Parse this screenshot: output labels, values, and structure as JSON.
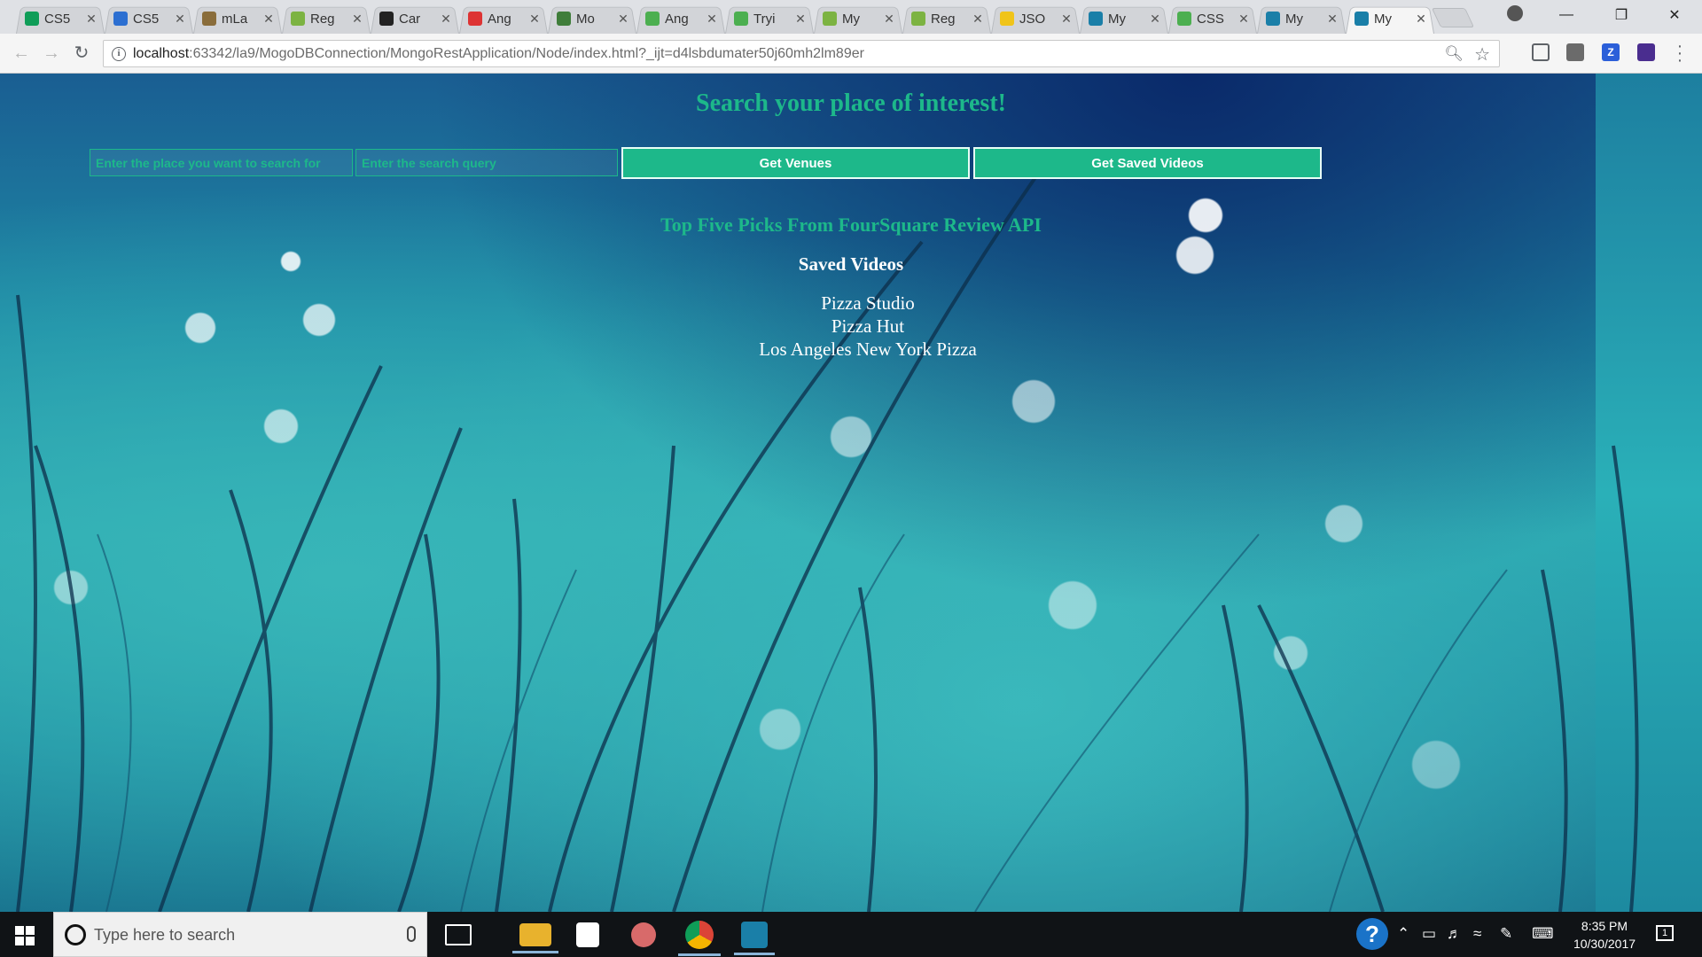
{
  "browser": {
    "tabs": [
      {
        "label": "CS5",
        "icon": "sheets-icon",
        "color": "#0f9d58",
        "active": false
      },
      {
        "label": "CS5",
        "icon": "box-icon",
        "color": "#2c6fd1",
        "active": false
      },
      {
        "label": "mLa",
        "icon": "mlab-icon",
        "color": "#8a6d3b",
        "active": false
      },
      {
        "label": "Reg",
        "icon": "android-icon",
        "color": "#7cb342",
        "active": false
      },
      {
        "label": "Car",
        "icon": "jetbrains-icon",
        "color": "#222222",
        "active": false
      },
      {
        "label": "Ang",
        "icon": "angular-icon",
        "color": "#dd3333",
        "active": false
      },
      {
        "label": "Mo",
        "icon": "mongodb-icon",
        "color": "#3f7d3a",
        "active": false
      },
      {
        "label": "Ang",
        "icon": "w3-icon",
        "color": "#4caf50",
        "active": false
      },
      {
        "label": "Tryi",
        "icon": "w3-icon",
        "color": "#4caf50",
        "active": false
      },
      {
        "label": "My",
        "icon": "android-icon",
        "color": "#7cb342",
        "active": false
      },
      {
        "label": "Reg",
        "icon": "android-icon",
        "color": "#7cb342",
        "active": false
      },
      {
        "label": "JSO",
        "icon": "json-icon",
        "color": "#f0c419",
        "active": false
      },
      {
        "label": "My",
        "icon": "webstorm-icon",
        "color": "#1a7fa8",
        "active": false
      },
      {
        "label": "CSS",
        "icon": "w3-icon",
        "color": "#4caf50",
        "active": false
      },
      {
        "label": "My",
        "icon": "webstorm-icon",
        "color": "#1a7fa8",
        "active": false
      },
      {
        "label": "My",
        "icon": "webstorm-icon",
        "color": "#1a7fa8",
        "active": true
      }
    ],
    "url_host": "localhost",
    "url_rest": ":63342/la9/MogoDBConnection/MongoRestApplication/Node/index.html?_ijt=d4lsbdumater50j60mh2lm89er",
    "extensions": [
      {
        "name": "cast-icon",
        "color": "#5f6368"
      },
      {
        "name": "extension-shield-icon",
        "color": "#6b6b6b"
      },
      {
        "name": "zotero-icon",
        "color": "#2b5fd9"
      },
      {
        "name": "extension-purple-icon",
        "color": "#4a2d8f"
      }
    ]
  },
  "page": {
    "title": "Search your place of interest!",
    "place_placeholder": "Enter the place you want to search for",
    "query_placeholder": "Enter the search query",
    "get_venues_label": "Get Venues",
    "get_saved_label": "Get Saved Videos",
    "subtitle": "Top Five Picks From FourSquare Review API",
    "saved_heading": "Saved Videos",
    "saved_items": [
      "Pizza Studio",
      "Pizza Hut",
      "Los Angeles New York Pizza"
    ],
    "accent_color": "#1db88a"
  },
  "taskbar": {
    "search_placeholder": "Type here to search",
    "time": "8:35 PM",
    "date": "10/30/2017",
    "notification_count": "1"
  }
}
